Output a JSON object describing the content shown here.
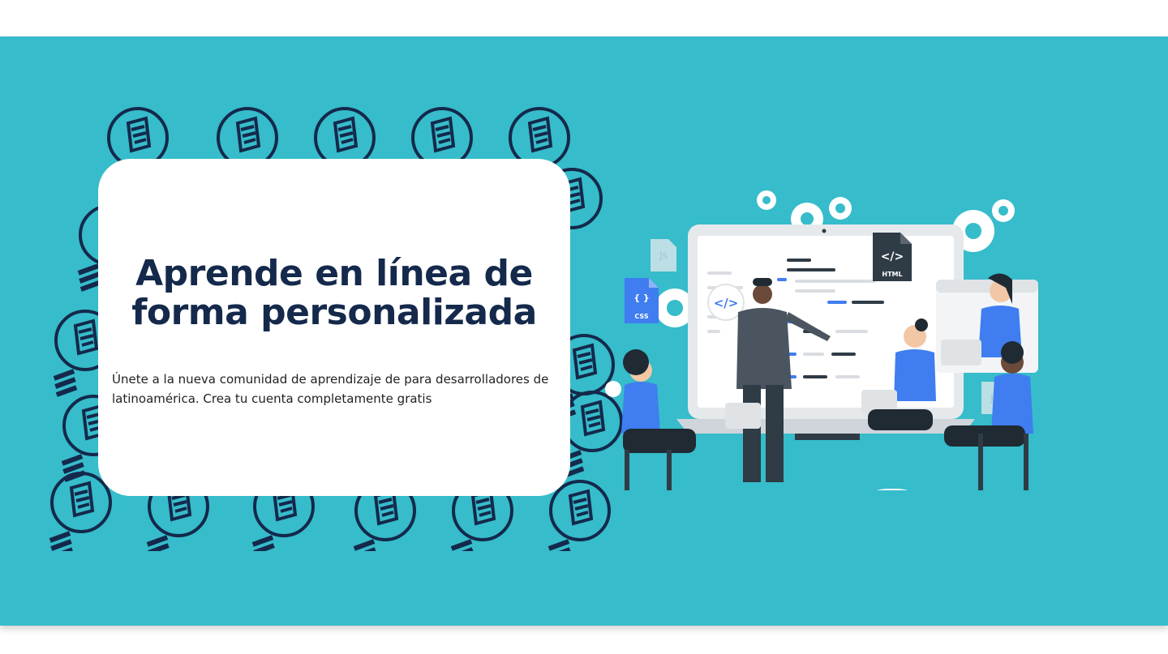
{
  "hero": {
    "title": "Aprende en línea de forma personalizada",
    "description": "Únete a la nueva comunidad de aprendizaje de para desarrolladores de latinoamérica. Crea tu cuenta completamente gratis",
    "background_color": "#36bccb",
    "title_color": "#14294b"
  },
  "illustration": {
    "html_badge": "HTML",
    "css_badge": "CSS",
    "js_badge": "Js",
    "code_symbol": "</>",
    "css_symbol": "{ }",
    "accent_color": "#3f7df0",
    "dark_color": "#2f3b45"
  },
  "icons": [
    "lightbulb-icon",
    "gear-icon",
    "html-file-icon",
    "css-file-icon",
    "js-file-icon",
    "code-icon"
  ]
}
